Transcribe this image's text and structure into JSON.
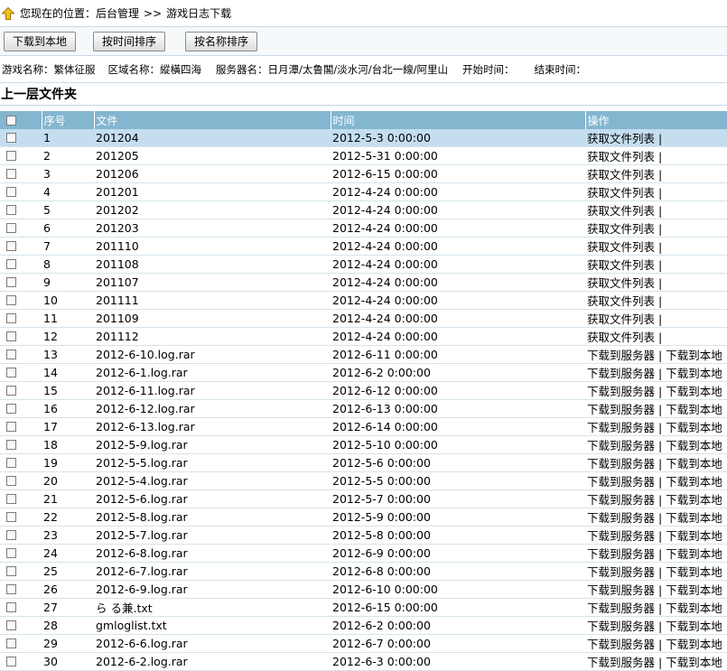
{
  "breadcrumb": {
    "label": "您现在的位置：",
    "home": "后台管理",
    "sep": ">>",
    "current": "游戏日志下载"
  },
  "toolbar": {
    "download_local": "下载到本地",
    "sort_time": "按时间排序",
    "sort_name": "按名称排序"
  },
  "info": {
    "game": "游戏名称：繁体征服",
    "region": "区域名称：縱橫四海",
    "server": "服务器名：日月潭/太鲁閣/淡水河/台北一線/阿里山",
    "start": "开始时间：",
    "end": "结束时间："
  },
  "parent_folder": "上一层文件夹",
  "table": {
    "headers": [
      "序号",
      "文件",
      "时间",
      "操作"
    ],
    "action_list": "获取文件列表",
    "action_server": "下载到服务器",
    "action_local": "下载到本地",
    "action_sep": "|",
    "rows": [
      {
        "no": "1",
        "file": "201204",
        "time": "2012-5-3 0:00:00",
        "type": "dir"
      },
      {
        "no": "2",
        "file": "201205",
        "time": "2012-5-31 0:00:00",
        "type": "dir"
      },
      {
        "no": "3",
        "file": "201206",
        "time": "2012-6-15 0:00:00",
        "type": "dir"
      },
      {
        "no": "4",
        "file": "201201",
        "time": "2012-4-24 0:00:00",
        "type": "dir"
      },
      {
        "no": "5",
        "file": "201202",
        "time": "2012-4-24 0:00:00",
        "type": "dir"
      },
      {
        "no": "6",
        "file": "201203",
        "time": "2012-4-24 0:00:00",
        "type": "dir"
      },
      {
        "no": "7",
        "file": "201110",
        "time": "2012-4-24 0:00:00",
        "type": "dir"
      },
      {
        "no": "8",
        "file": "201108",
        "time": "2012-4-24 0:00:00",
        "type": "dir"
      },
      {
        "no": "9",
        "file": "201107",
        "time": "2012-4-24 0:00:00",
        "type": "dir"
      },
      {
        "no": "10",
        "file": "201111",
        "time": "2012-4-24 0:00:00",
        "type": "dir"
      },
      {
        "no": "11",
        "file": "201109",
        "time": "2012-4-24 0:00:00",
        "type": "dir"
      },
      {
        "no": "12",
        "file": "201112",
        "time": "2012-4-24 0:00:00",
        "type": "dir"
      },
      {
        "no": "13",
        "file": "2012-6-10.log.rar",
        "time": "2012-6-11 0:00:00",
        "type": "file"
      },
      {
        "no": "14",
        "file": "2012-6-1.log.rar",
        "time": "2012-6-2 0:00:00",
        "type": "file"
      },
      {
        "no": "15",
        "file": "2012-6-11.log.rar",
        "time": "2012-6-12 0:00:00",
        "type": "file"
      },
      {
        "no": "16",
        "file": "2012-6-12.log.rar",
        "time": "2012-6-13 0:00:00",
        "type": "file"
      },
      {
        "no": "17",
        "file": "2012-6-13.log.rar",
        "time": "2012-6-14 0:00:00",
        "type": "file"
      },
      {
        "no": "18",
        "file": "2012-5-9.log.rar",
        "time": "2012-5-10 0:00:00",
        "type": "file"
      },
      {
        "no": "19",
        "file": "2012-5-5.log.rar",
        "time": "2012-5-6 0:00:00",
        "type": "file"
      },
      {
        "no": "20",
        "file": "2012-5-4.log.rar",
        "time": "2012-5-5 0:00:00",
        "type": "file"
      },
      {
        "no": "21",
        "file": "2012-5-6.log.rar",
        "time": "2012-5-7 0:00:00",
        "type": "file"
      },
      {
        "no": "22",
        "file": "2012-5-8.log.rar",
        "time": "2012-5-9 0:00:00",
        "type": "file"
      },
      {
        "no": "23",
        "file": "2012-5-7.log.rar",
        "time": "2012-5-8 0:00:00",
        "type": "file"
      },
      {
        "no": "24",
        "file": "2012-6-8.log.rar",
        "time": "2012-6-9 0:00:00",
        "type": "file"
      },
      {
        "no": "25",
        "file": "2012-6-7.log.rar",
        "time": "2012-6-8 0:00:00",
        "type": "file"
      },
      {
        "no": "26",
        "file": "2012-6-9.log.rar",
        "time": "2012-6-10 0:00:00",
        "type": "file"
      },
      {
        "no": "27",
        "file": "ら る兼.txt",
        "time": "2012-6-15 0:00:00",
        "type": "file"
      },
      {
        "no": "28",
        "file": "gmloglist.txt",
        "time": "2012-6-2 0:00:00",
        "type": "file"
      },
      {
        "no": "29",
        "file": "2012-6-6.log.rar",
        "time": "2012-6-7 0:00:00",
        "type": "file"
      },
      {
        "no": "30",
        "file": "2012-6-2.log.rar",
        "time": "2012-6-3 0:00:00",
        "type": "file"
      }
    ]
  }
}
